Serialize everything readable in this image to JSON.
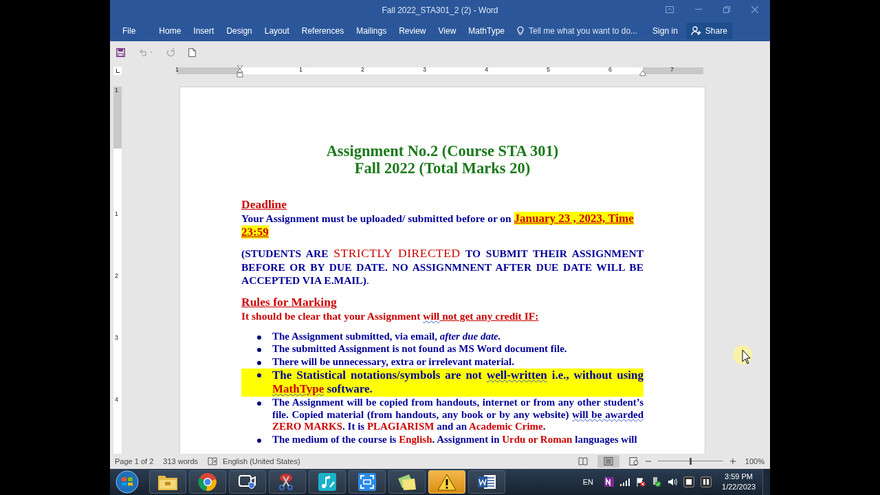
{
  "window": {
    "title": "Fall 2022_STA301_2 (2) - Word"
  },
  "ribbon": {
    "tabs": [
      {
        "label": "File",
        "selected": false
      },
      {
        "label": "Home",
        "selected": false
      },
      {
        "label": "Insert",
        "selected": false
      },
      {
        "label": "Design",
        "selected": false
      },
      {
        "label": "Layout",
        "selected": false
      },
      {
        "label": "References",
        "selected": false
      },
      {
        "label": "Mailings",
        "selected": false
      },
      {
        "label": "Review",
        "selected": false
      },
      {
        "label": "View",
        "selected": false
      },
      {
        "label": "MathType",
        "selected": false
      }
    ],
    "tell_me": "Tell me what you want to do...",
    "sign_in": "Sign in",
    "share": "Share"
  },
  "ruler": {
    "labels": [
      "1",
      "1",
      "2",
      "3",
      "4",
      "5",
      "6",
      "7"
    ]
  },
  "vertical_ruler": {
    "labels": [
      "1",
      "1",
      "2",
      "3",
      "4"
    ]
  },
  "document": {
    "title_lines": [
      "Assignment No.2 (Course STA 301)",
      "Fall 2022 (Total Marks 20)"
    ],
    "blocks": [
      {
        "kind": "heading",
        "text": "Deadline"
      },
      {
        "kind": "paragraph",
        "runs": [
          {
            "kind": "normal",
            "text": "Your Assignment must be uploaded/ submitted before or on "
          },
          {
            "kind": "deadline",
            "text": "January 23 , 2023, Time 23:59"
          }
        ]
      },
      {
        "kind": "notice",
        "runs": [
          {
            "kind": "normal",
            "text": "(STUDENTS ARE "
          },
          {
            "kind": "stress",
            "text": "STRICTLY DIRECTED"
          },
          {
            "kind": "normal",
            "text": " TO SUBMIT THEIR ASSIGNMENT BEFORE OR BY DUE DATE. NO ASSIGNMNENT AFTER DUE DATE WILL BE ACCEPTED VIA E.MAIL)"
          },
          {
            "kind": "light",
            "text": "."
          }
        ]
      },
      {
        "kind": "heading",
        "text": "Rules for Marking"
      },
      {
        "kind": "paragraph",
        "runs": [
          {
            "kind": "emphasis",
            "text": "It should be clear that your Assignment "
          },
          {
            "kind": "emphasis-flagged",
            "text": "will"
          },
          {
            "kind": "emphasis-underlined",
            "text": " not get any credit IF:"
          }
        ]
      },
      {
        "kind": "list",
        "items": [
          {
            "highlighted": false,
            "runs": [
              {
                "kind": "normal",
                "text": "The Assignment submitted, via email, "
              },
              {
                "kind": "italic",
                "text": "after due date."
              }
            ]
          },
          {
            "highlighted": false,
            "runs": [
              {
                "kind": "normal",
                "text": "The submitted Assignment is not found as MS Word document file."
              }
            ]
          },
          {
            "highlighted": false,
            "runs": [
              {
                "kind": "normal",
                "text": "There will be unnecessary, extra or irrelevant material."
              }
            ]
          },
          {
            "highlighted": true,
            "runs": [
              {
                "kind": "normal",
                "text": "The Statistical notations/symbols are not "
              },
              {
                "kind": "flagged",
                "text": "well-written"
              },
              {
                "kind": "normal",
                "text": " i.e., without using "
              },
              {
                "kind": "emphasis-flagged",
                "text": "MathType"
              },
              {
                "kind": "normal",
                "text": " software."
              }
            ]
          },
          {
            "highlighted": false,
            "runs": [
              {
                "kind": "normal",
                "text": "The Assignment will be copied from handouts, internet or from any other student’s file. Copied material (from handouts, any book or by any website) "
              },
              {
                "kind": "flagged",
                "text": "will be awarded"
              },
              {
                "kind": "emphasis",
                "text": " ZERO MARKS"
              },
              {
                "kind": "normal",
                "text": ". It is "
              },
              {
                "kind": "emphasis",
                "text": "PLAGIARISM"
              },
              {
                "kind": "normal",
                "text": " and an "
              },
              {
                "kind": "emphasis",
                "text": "Academic Crime"
              },
              {
                "kind": "normal",
                "text": "."
              }
            ]
          },
          {
            "highlighted": false,
            "runs": [
              {
                "kind": "normal",
                "text": "The medium of the course is "
              },
              {
                "kind": "emphasis",
                "text": "English"
              },
              {
                "kind": "normal",
                "text": ". Assignment in "
              },
              {
                "kind": "emphasis",
                "text": "Urdu or Roman"
              },
              {
                "kind": "normal",
                "text": " languages will"
              }
            ]
          }
        ]
      }
    ]
  },
  "status_bar": {
    "page": "Page 1 of 2",
    "words": "313 words",
    "language": "English (United States)",
    "zoom": "100%",
    "zoom_slider": {
      "level": 0.5
    }
  },
  "taskbar": {
    "apps": [
      {
        "kind": "explorer",
        "selected": false
      },
      {
        "kind": "chrome",
        "selected": false
      },
      {
        "kind": "camera",
        "selected": false
      },
      {
        "kind": "scissors",
        "selected": false
      },
      {
        "kind": "music",
        "selected": false
      },
      {
        "kind": "capture",
        "selected": false
      },
      {
        "kind": "notes",
        "selected": false
      },
      {
        "kind": "warning",
        "selected": true
      },
      {
        "kind": "word",
        "selected": false
      }
    ],
    "input_language": "EN",
    "time": "3:59 PM",
    "date": "1/22/2023"
  }
}
